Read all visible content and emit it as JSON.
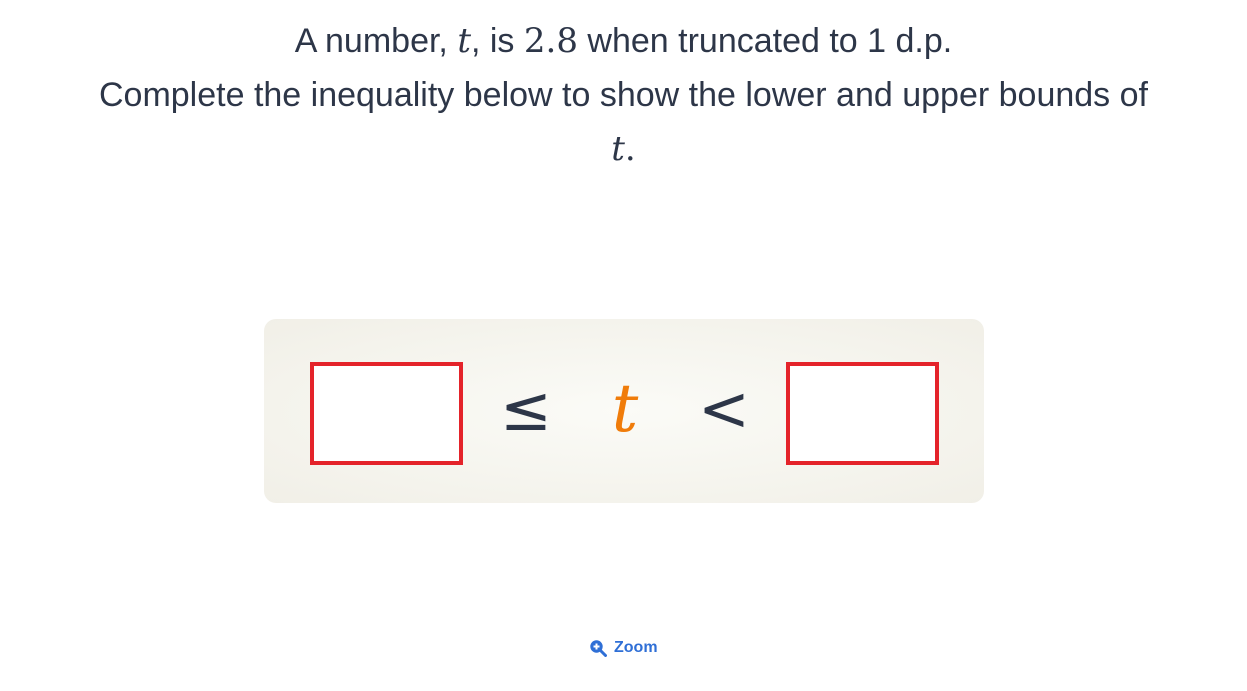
{
  "question": {
    "line1": {
      "prefix": "A number, ",
      "variable": "t",
      "middle": ", is ",
      "value": "2.8",
      "suffix": " when truncated to 1 d.p."
    },
    "line2": "Complete the inequality below to show the lower and upper bounds of",
    "line3": {
      "variable": "t",
      "suffix": "."
    }
  },
  "inequality": {
    "lower_value": "",
    "lower_symbol": "≤",
    "variable": "t",
    "upper_symbol": "<",
    "upper_value": ""
  },
  "zoom": {
    "label": "Zoom",
    "icon": "zoom-in-icon"
  },
  "colors": {
    "text": "#2d3648",
    "variable_accent": "#f07c0a",
    "box_border": "#e4232a",
    "link": "#2f6fd6",
    "panel_bg": "#f4f3ec"
  }
}
